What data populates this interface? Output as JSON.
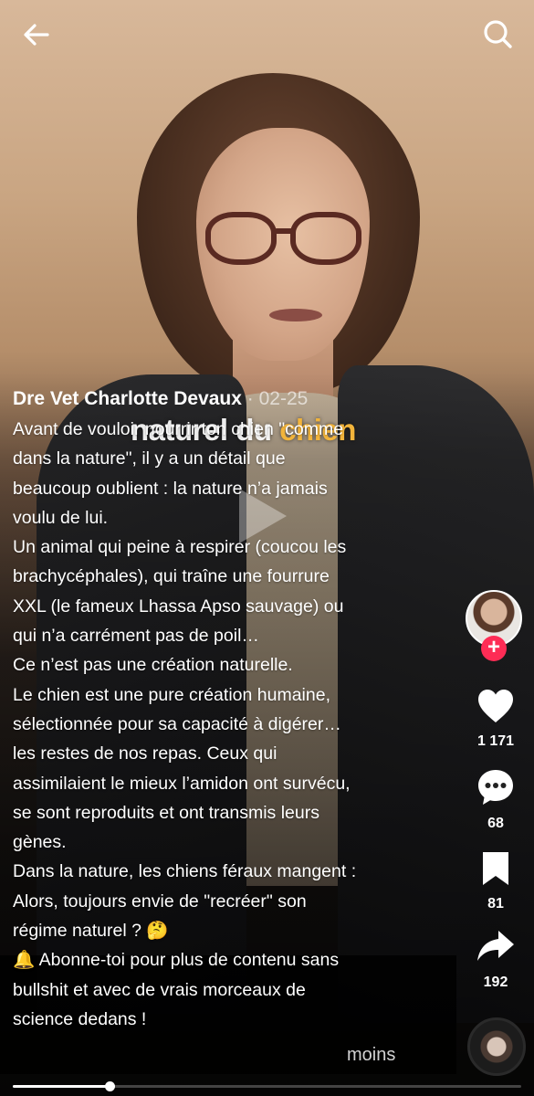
{
  "video": {
    "burned_caption": {
      "normal": "naturel du ",
      "highlight": "chien"
    },
    "progress": 0.19
  },
  "post": {
    "author": "Dre Vet Charlotte Devaux",
    "separator": " · ",
    "date": "02-25",
    "description_lines": [
      "Avant de vouloir nourrir ton chien \"comme",
      "dans la nature\", il y a un détail que",
      "beaucoup oublient : la nature n’a jamais",
      "voulu de lui.",
      "Un animal qui peine à respirer (coucou les",
      "brachycéphales), qui traîne une fourrure",
      "XXL (le fameux Lhassa Apso sauvage) ou",
      "qui n’a carrément pas de poil…",
      "Ce n’est pas une création naturelle.",
      "Le chien est une pure création humaine,",
      "sélectionnée pour sa capacité à digérer…",
      "les restes de nos repas. Ceux qui",
      "assimilaient le mieux l’amidon ont survécu,",
      "se sont reproduits et ont transmis leurs",
      "gènes.",
      "Dans la nature, les chiens féraux mangent :",
      "Alors, toujours envie de \"recréer\" son",
      "régime naturel ? 🤔",
      "🔔 Abonne-toi pour plus de contenu sans",
      "bullshit et avec de vrais morceaux de",
      "science dedans !"
    ],
    "less_label": "moins"
  },
  "actions": {
    "follow_symbol": "+",
    "likes": "1 171",
    "comments": "68",
    "saves": "81",
    "shares": "192"
  },
  "icons": {
    "back": "arrow-left-icon",
    "search": "search-icon",
    "like": "heart-icon",
    "comment": "comment-bubble-icon",
    "save": "bookmark-icon",
    "share": "share-arrow-icon"
  },
  "colors": {
    "follow": "#fe2c55",
    "caption_highlight": "#f2b43b"
  }
}
